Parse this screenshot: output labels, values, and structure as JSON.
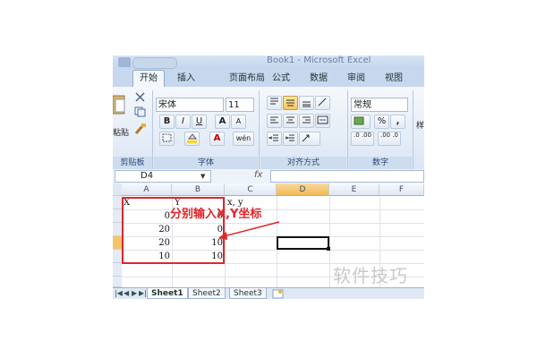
{
  "window": {
    "title": "Book1 - Microsoft Excel"
  },
  "tabs": [
    "开始",
    "插入",
    "页面布局",
    "公式",
    "数据",
    "审阅",
    "视图"
  ],
  "ribbon": {
    "paste_label": "粘贴",
    "clipboard_label": "剪贴板",
    "font_name": "宋体",
    "font_size": "11",
    "bold": "B",
    "italic": "I",
    "underline": "U",
    "grow_font": "A",
    "shrink_font": "A",
    "font_color": "A",
    "phonetic": "wén",
    "font_group": "字体",
    "align_group": "对齐方式",
    "number_format": "常规",
    "percent": "%",
    "comma": ",",
    "increase_decimal": ".0 .00",
    "decrease_decimal": ".00 .0",
    "number_group": "数字",
    "styles_partial": "样"
  },
  "formula_bar": {
    "name_box": "D4",
    "fx": "fx",
    "content": ""
  },
  "sheet": {
    "columns": [
      "A",
      "B",
      "C",
      "D",
      "E",
      "F"
    ],
    "selected_column": "D",
    "rows": [
      {
        "a": "X",
        "b": "Y",
        "c": "x, y"
      },
      {
        "a": "0",
        "b": "0",
        "c": ""
      },
      {
        "a": "20",
        "b": "0",
        "c": ""
      },
      {
        "a": "20",
        "b": "10",
        "c": ""
      },
      {
        "a": "10",
        "b": "10",
        "c": ""
      }
    ],
    "active_cell": "D4"
  },
  "annotation": {
    "text": "分别输入X,Y坐标",
    "color": "#e0262a"
  },
  "sheet_tabs": [
    "Sheet1",
    "Sheet2",
    "Sheet3"
  ],
  "watermark": "软件技巧"
}
